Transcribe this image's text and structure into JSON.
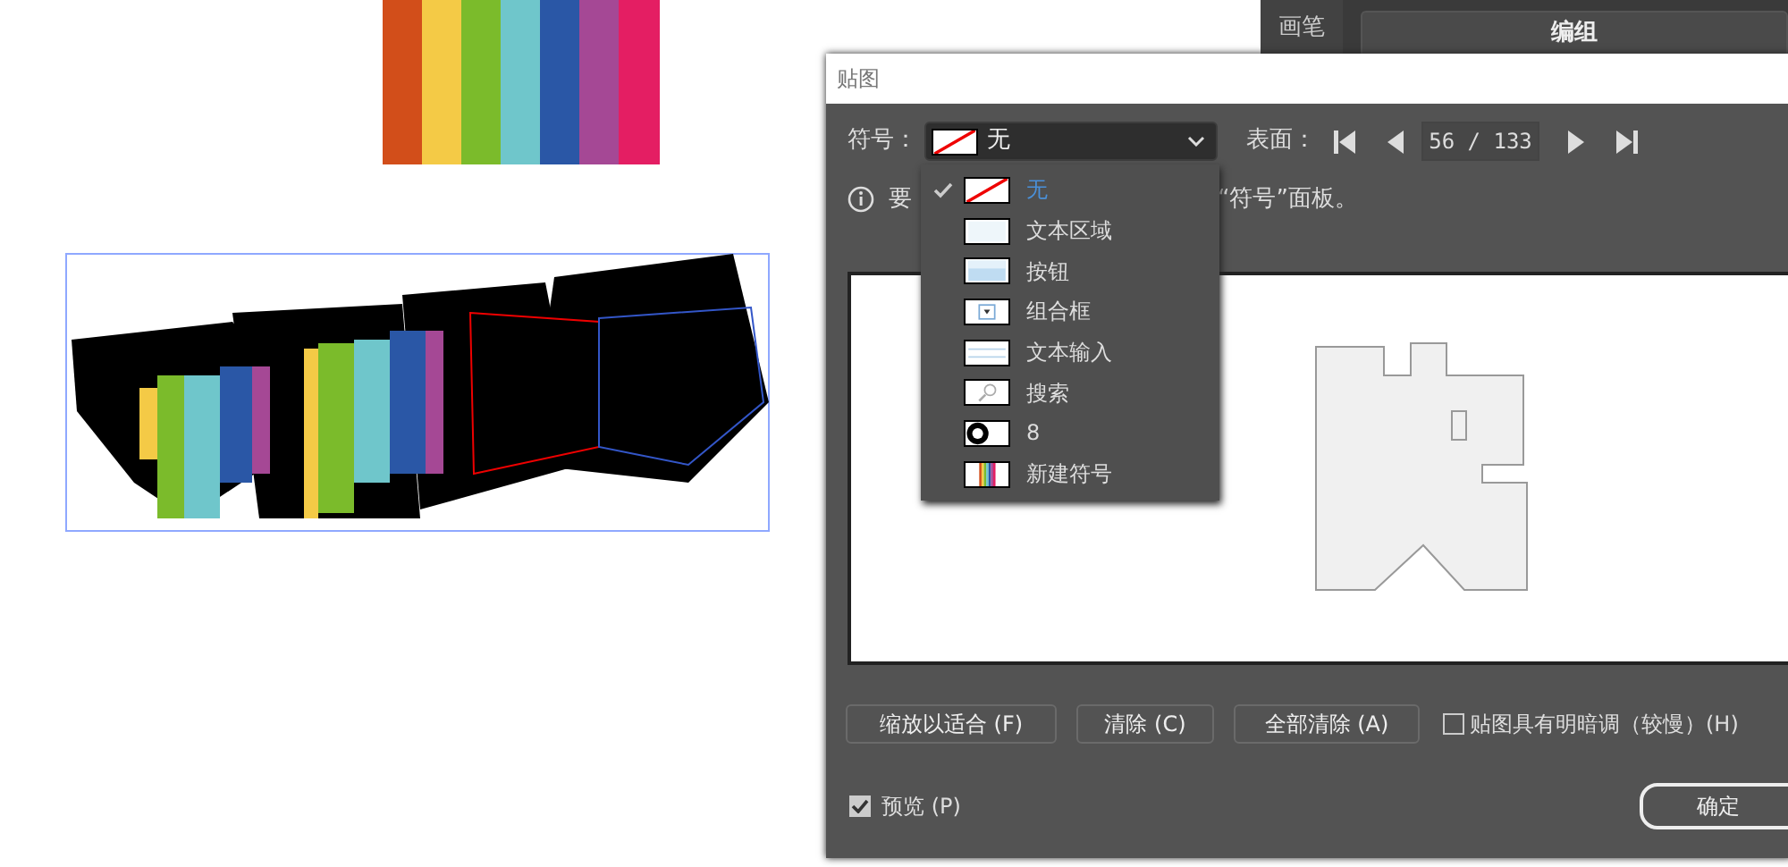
{
  "side_panel": {
    "tab": "画笔",
    "button": "编组"
  },
  "dialog": {
    "title": "贴图",
    "symbol": {
      "label": "符号：",
      "value": "无",
      "expanded": true
    },
    "surface": {
      "label": "表面：",
      "value": "56 / 133"
    },
    "menu": [
      {
        "label": "无",
        "kind": "none",
        "selected": true
      },
      {
        "label": "文本区域",
        "kind": "textarea",
        "selected": false
      },
      {
        "label": "按钮",
        "kind": "button",
        "selected": false
      },
      {
        "label": "组合框",
        "kind": "combo",
        "selected": false
      },
      {
        "label": "文本输入",
        "kind": "input",
        "selected": false
      },
      {
        "label": "搜索",
        "kind": "search",
        "selected": false
      },
      {
        "label": "8",
        "kind": "ball",
        "selected": false
      },
      {
        "label": "新建符号",
        "kind": "stripes",
        "selected": false
      }
    ],
    "info": {
      "start": "要",
      "end": "“符号”面板。"
    },
    "buttons": [
      "缩放以适合 (F)",
      "清除 (C)",
      "全部清除 (A)"
    ],
    "shading": {
      "label": "贴图具有明暗调（较慢）(H)",
      "checked": false
    },
    "preview": {
      "label": "预览 (P)",
      "checked": true
    },
    "ok": "确定"
  }
}
